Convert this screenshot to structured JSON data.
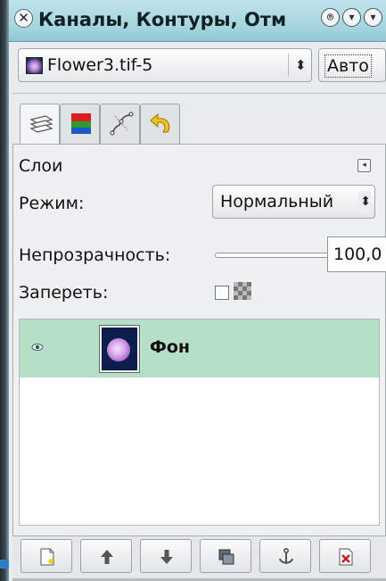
{
  "window": {
    "title": "Каналы, Контуры, Отм",
    "close_glyph": "✕",
    "shade_glyph": "⌾",
    "roll_glyph": "▾",
    "menu_glyph": "▾"
  },
  "image_selector": {
    "value": "Flower3.tif-5",
    "arrows": "⬍",
    "auto_label": "Авто"
  },
  "tabs": [
    {
      "name": "layers",
      "active": true
    },
    {
      "name": "channels",
      "active": false
    },
    {
      "name": "paths",
      "active": false
    },
    {
      "name": "undo-history",
      "active": false
    }
  ],
  "layers_panel": {
    "title": "Слои",
    "menu_glyph": "◂",
    "mode_label": "Режим:",
    "mode_value": "Нормальный",
    "mode_arrows": "⬍",
    "opacity_label": "Непрозрачность:",
    "opacity_value": "100,0",
    "lock_label": "Запереть:"
  },
  "layers": [
    {
      "name": "Фон",
      "visible": true,
      "selected": true
    }
  ],
  "bottom_toolbar": [
    {
      "name": "new-layer"
    },
    {
      "name": "raise-layer"
    },
    {
      "name": "lower-layer"
    },
    {
      "name": "duplicate-layer"
    },
    {
      "name": "anchor-layer"
    },
    {
      "name": "delete-layer"
    }
  ],
  "colors": {
    "titlebar": "#a4d4de",
    "selected_row": "#b6dfc8",
    "panel_bg": "#eef0f1"
  }
}
